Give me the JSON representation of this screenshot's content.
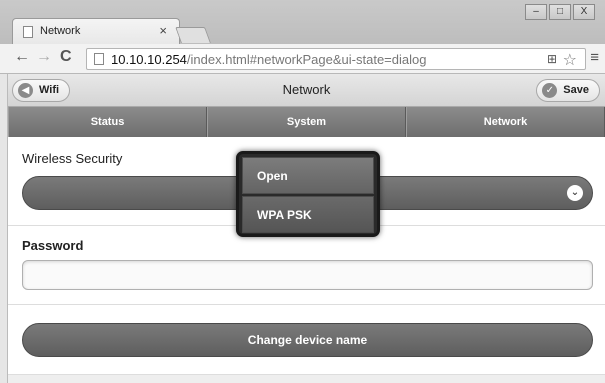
{
  "browser": {
    "tab_title": "Network",
    "tab_close": "×",
    "window_controls": [
      "–",
      "□",
      "X"
    ],
    "url_host": "10.10.10.254",
    "url_path": "/index.html#networkPage&ui-state=dialog"
  },
  "header": {
    "left_button": "Wifi",
    "title": "Network",
    "right_button": "Save"
  },
  "navbar": {
    "tabs": [
      "Status",
      "System",
      "Network"
    ]
  },
  "form": {
    "wireless_security_label": "Wireless Security",
    "password_label": "Password",
    "password_value": "",
    "change_name_button": "Change device name"
  },
  "dropdown": {
    "options": [
      "Open",
      "WPA PSK"
    ],
    "selected": "WPA PSK"
  },
  "icons": {
    "back": "back-arrow-icon",
    "forward": "forward-arrow-icon",
    "reload": "reload-icon",
    "star": "star-icon",
    "menu": "menu-icon",
    "wifi_button": "arrow-circle-icon",
    "save_button": "check-circle-icon",
    "select": "chevron-down-icon"
  }
}
